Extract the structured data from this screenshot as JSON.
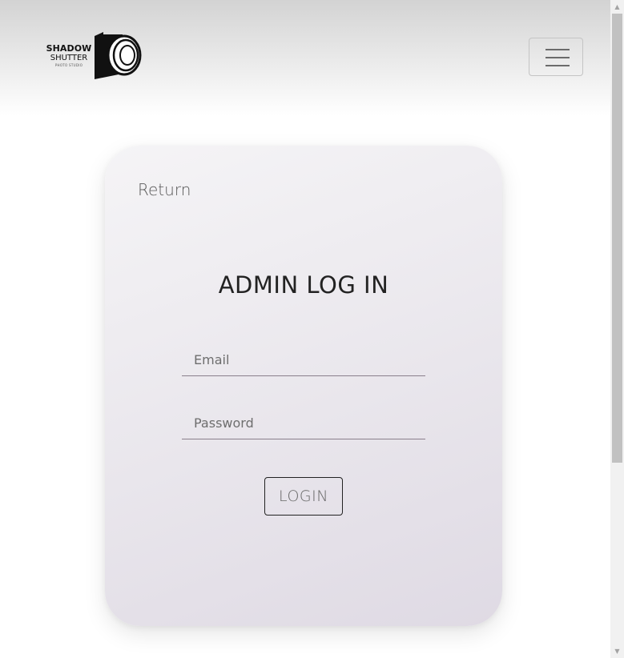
{
  "header": {
    "logo": {
      "line1": "SHADOW",
      "line2": "SHUTTER",
      "line3": "PHOTO STUDIO"
    },
    "menu_icon": "hamburger-icon"
  },
  "login": {
    "return_label": "Return",
    "title": "ADMIN LOG IN",
    "email_placeholder": "Email",
    "password_placeholder": "Password",
    "login_label": "LOGIN"
  },
  "scrollbar": {
    "up_icon": "scroll-up-arrow-icon",
    "down_icon": "scroll-down-arrow-icon",
    "up_glyph": "▲",
    "down_glyph": "▼"
  },
  "colors": {
    "header_gradient_top": "#d3d3d3",
    "card_gradient_start": "#f5f4f6",
    "card_gradient_end": "#dfdae4",
    "text_dark": "#222222"
  }
}
